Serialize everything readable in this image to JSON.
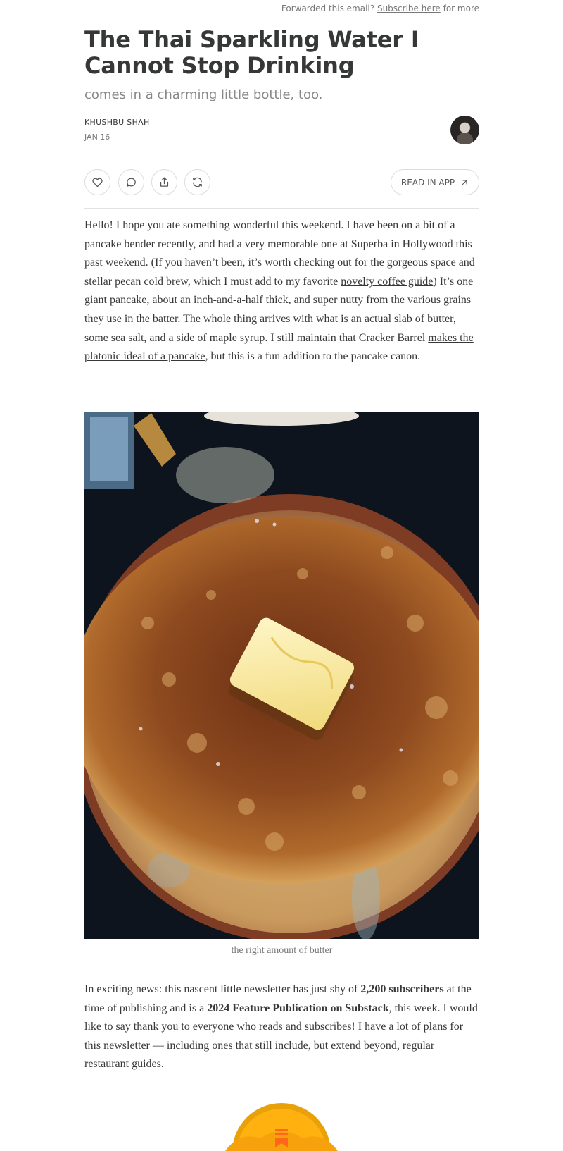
{
  "header": {
    "forward_prefix": "Forwarded this email?",
    "subscribe_link": "Subscribe here",
    "forward_suffix": "for more"
  },
  "post": {
    "title": "The Thai Sparkling Water I Cannot Stop Drinking",
    "subtitle": "comes in a charming little bottle, too.",
    "author": "KHUSHBU SHAH",
    "date": "JAN 16"
  },
  "actions": {
    "like_icon": "heart-icon",
    "comment_icon": "comment-icon",
    "share_icon": "share-icon",
    "restack_icon": "restack-icon",
    "read_in_app": "READ IN APP",
    "read_in_app_icon": "arrow-up-right-icon"
  },
  "paragraph1": {
    "p1": "Hello! I hope you ate something wonderful this weekend. I have been on a bit of a pancake bender recently, and had a very memorable one at Superba in Hollywood this past weekend. (If you haven’t been, it’s worth checking out for the gorgeous space and stellar pecan cold brew, which I must add to my favorite ",
    "link1": "novelty coffee guide",
    "p2": ") It’s one giant pancake, about an inch-and-a-half thick, and super nutty from the various grains they use in the batter. The whole thing arrives with what is an actual slab of butter, some sea salt, and a side of maple syrup. I still maintain that Cracker Barrel ",
    "link2": "makes the platonic ideal of a pancake",
    "p3": ", but this is a fun addition to the pancake canon."
  },
  "image": {
    "caption": "the right amount of butter"
  },
  "paragraph2": {
    "p1": "In exciting news: this nascent little newsletter has just shy of ",
    "b1": "2,200 subscribers",
    "p2": " at the time of publishing and is a ",
    "b2": "2024 Feature Publication on Substack",
    "p3": ", this week. I would like to say thank you to everyone who reads and subscribes! I have a lot of plans for this newsletter — including ones that still include, but extend beyond, regular restaurant guides."
  },
  "colors": {
    "text": "#363737",
    "muted": "#777777",
    "badge_orange": "#FF6719",
    "badge_gold": "#FFB20F"
  }
}
